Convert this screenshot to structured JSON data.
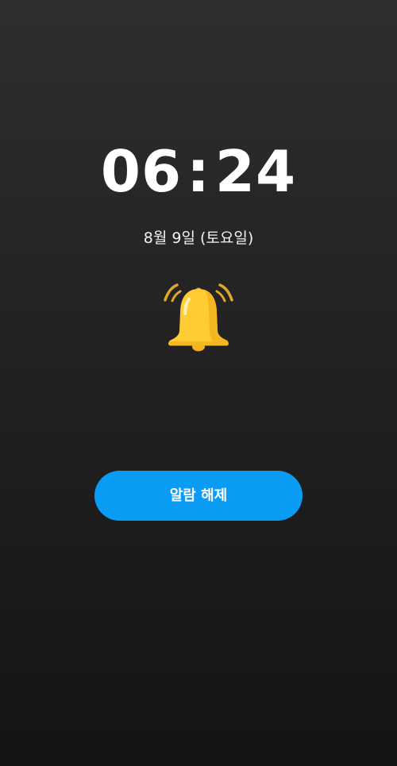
{
  "alarm": {
    "time": {
      "hours": "06",
      "separator": ":",
      "minutes": "24"
    },
    "date": "8월 9일 (토요일)",
    "icon": "bell-ringing-icon",
    "dismiss_label": "알람 해제"
  },
  "colors": {
    "background_top": "#2e2e2e",
    "background_bottom": "#141414",
    "accent": "#0a9bf5",
    "bell": "#ffcc33"
  }
}
